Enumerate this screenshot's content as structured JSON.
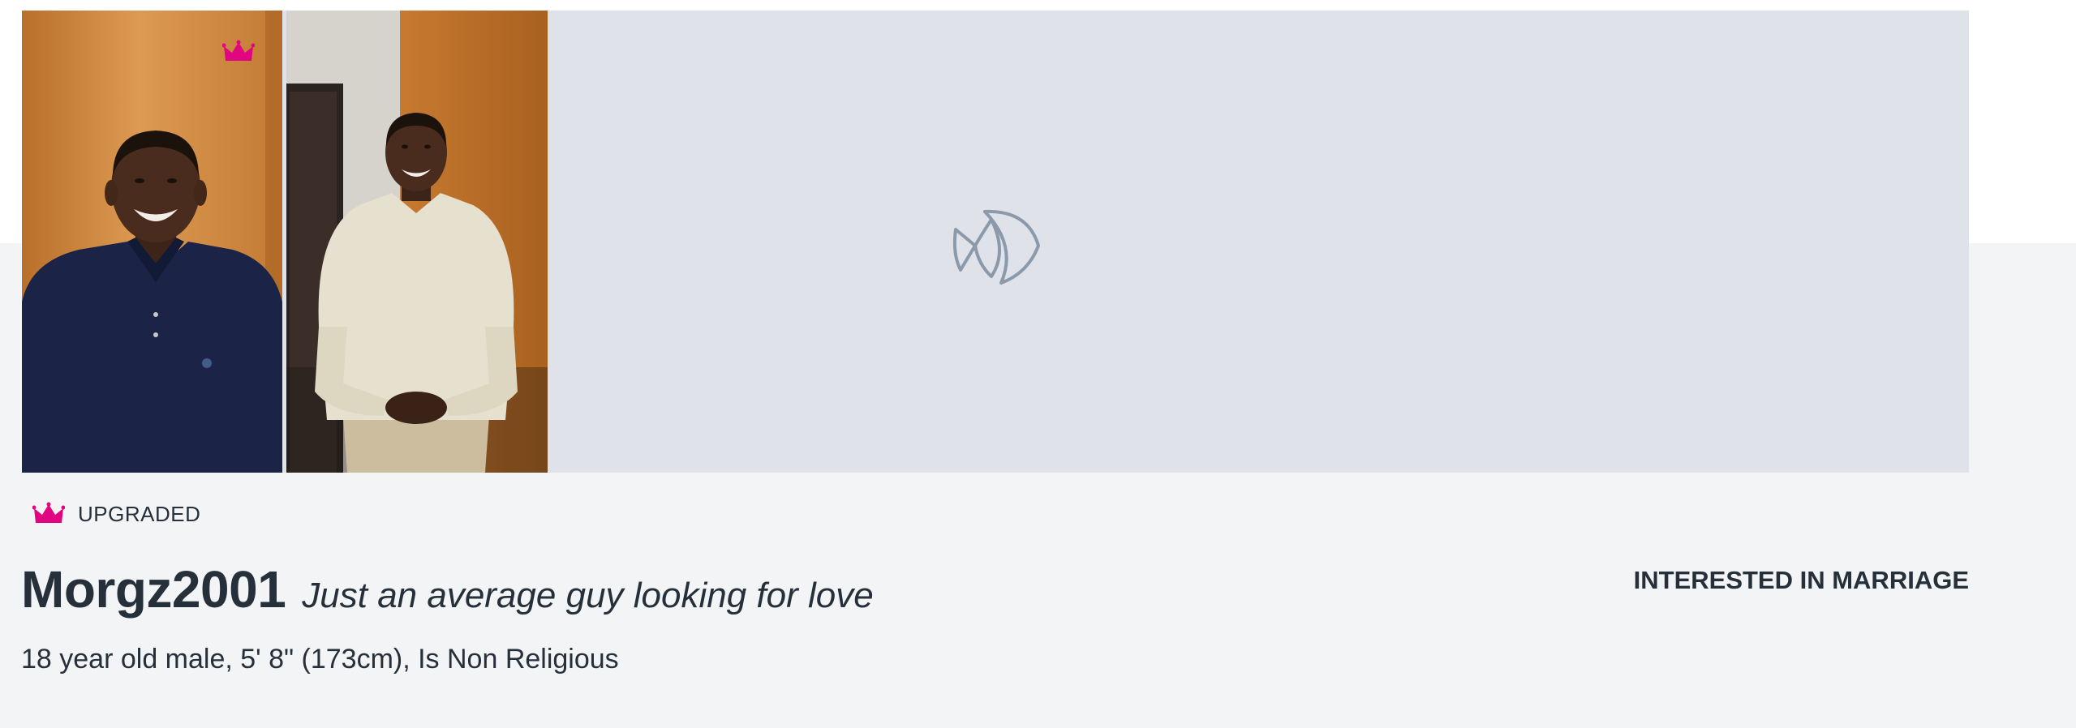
{
  "profile": {
    "badge_label": "UPGRADED",
    "username": "Morgz2001",
    "tagline": "Just an average guy looking for love",
    "interest": "INTERESTED IN MARRIAGE",
    "details": "18 year old male, 5' 8\" (173cm), Is Non Religious"
  },
  "icons": {
    "upgrade": "crown-icon",
    "placeholder": "fish-logo-icon"
  },
  "colors": {
    "crown": "#e0067f",
    "text": "#26303b",
    "gallery_bg": "#dfe2e8",
    "page_bg": "#f3f4f6",
    "fish": "#8b9aab"
  }
}
